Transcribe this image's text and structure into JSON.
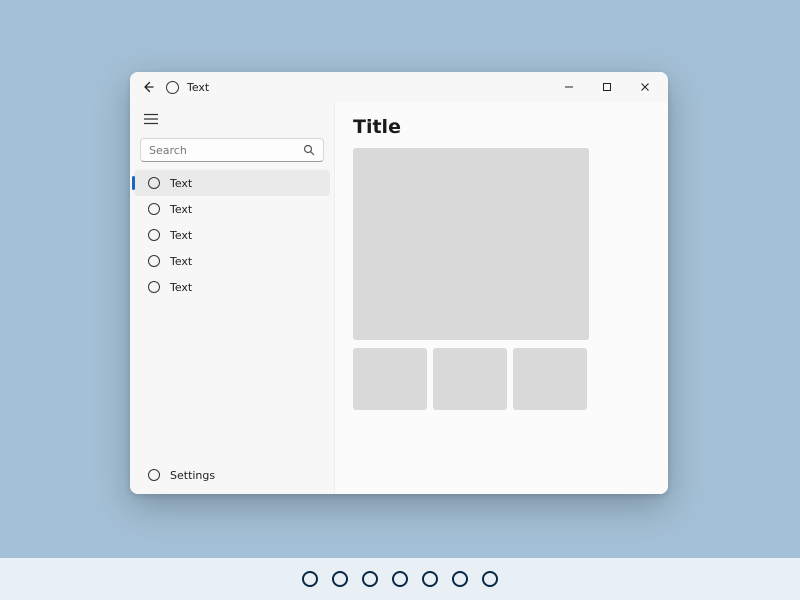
{
  "titlebar": {
    "title": "Text"
  },
  "sidebar": {
    "search_placeholder": "Search",
    "items": [
      {
        "label": "Text",
        "selected": true
      },
      {
        "label": "Text",
        "selected": false
      },
      {
        "label": "Text",
        "selected": false
      },
      {
        "label": "Text",
        "selected": false
      },
      {
        "label": "Text",
        "selected": false
      }
    ],
    "footer": {
      "label": "Settings"
    }
  },
  "content": {
    "title": "Title"
  },
  "taskbar": {
    "item_count": 7
  }
}
